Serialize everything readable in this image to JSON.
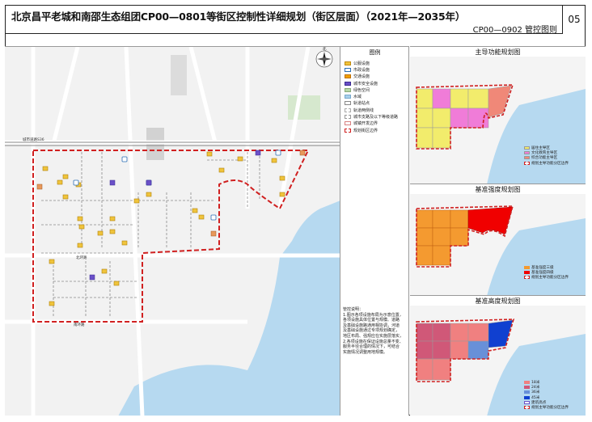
{
  "header": {
    "title": "北京昌平老城和南邵生态组团CP00—0801等街区控制性详细规划（街区层面）（2021年—2035年）",
    "subtitle": "CP00—0902  管控图则",
    "page_number": "05"
  },
  "map": {
    "road_labels": [
      "城市道路S36",
      "北环路",
      "南环路",
      "东环路",
      "西环路",
      "府学路",
      "鼓楼南街",
      "南街"
    ],
    "compass": "北"
  },
  "legend": {
    "title": "图例",
    "items": [
      {
        "label": "公服设施",
        "color": "#f0c43c",
        "border": "#c08a10"
      },
      {
        "label": "市政设施",
        "color": "#ffffff",
        "border": "#2a6db5"
      },
      {
        "label": "交通设施",
        "color": "#f0a000",
        "border": "#c07000"
      },
      {
        "label": "城市安全设施",
        "color": "#6a50c8",
        "border": "#3a2a90"
      },
      {
        "label": "绿色空间",
        "color": "#b8d8a8",
        "border": "#88a878"
      },
      {
        "label": "水域",
        "color": "#a8d0ec",
        "border": "#78a8cc"
      },
      {
        "label": "轨道站点",
        "color": "#ffffff",
        "border": "#888888"
      },
      {
        "label": "轨道两侧线",
        "color": "#ffffff",
        "border": "#aaaaaa"
      },
      {
        "label": "城市支路及以下等级道路",
        "color": "#ffffff",
        "border": "#999999"
      },
      {
        "label": "城镇开发边界",
        "color": "#ffffff",
        "border": "#d88080"
      },
      {
        "label": "规划街区边界",
        "color": "#ffffff",
        "border": "#d02020"
      }
    ],
    "notes_title": "管控说明：",
    "notes": [
      "1.图示各项设施布局为示意位置，",
      "各项设施具体位置与规模、道路",
      "及基础设施路通用相协调，河道",
      "及基础设施通过专项规划确定，",
      "地区布局、强规应在实施层落实，",
      "2.各项设施在保证设施总量不变、",
      "服务半径合理的情况下，可结合",
      "实施情况调整用地规模。"
    ]
  },
  "panels": [
    {
      "title": "主导功能规划图",
      "legend": [
        {
          "label": "居住主导区",
          "color": "#f2ec6c"
        },
        {
          "label": "文化教育主导区",
          "color": "#f07cd8"
        },
        {
          "label": "综合功能主导区",
          "color": "#f08878"
        },
        {
          "label": "规划主导功能分区边界",
          "color": "#ffffff"
        }
      ]
    },
    {
      "title": "基准强度规划图",
      "legend": [
        {
          "label": "基准强度三级",
          "color": "#f49a30"
        },
        {
          "label": "基准强度四级",
          "color": "#f00000"
        },
        {
          "label": "规划主导功能分区边界",
          "color": "#ffffff"
        }
      ]
    },
    {
      "title": "基准高度规划图",
      "legend": [
        {
          "label": "18米",
          "color": "#f08080"
        },
        {
          "label": "24米",
          "color": "#d05878"
        },
        {
          "label": "36米",
          "color": "#6890d8"
        },
        {
          "label": "45米",
          "color": "#1040d0"
        },
        {
          "label": "建筑高点",
          "color": "#ffffff"
        },
        {
          "label": "规划主导功能分区边界",
          "color": "#ffffff"
        }
      ]
    }
  ]
}
